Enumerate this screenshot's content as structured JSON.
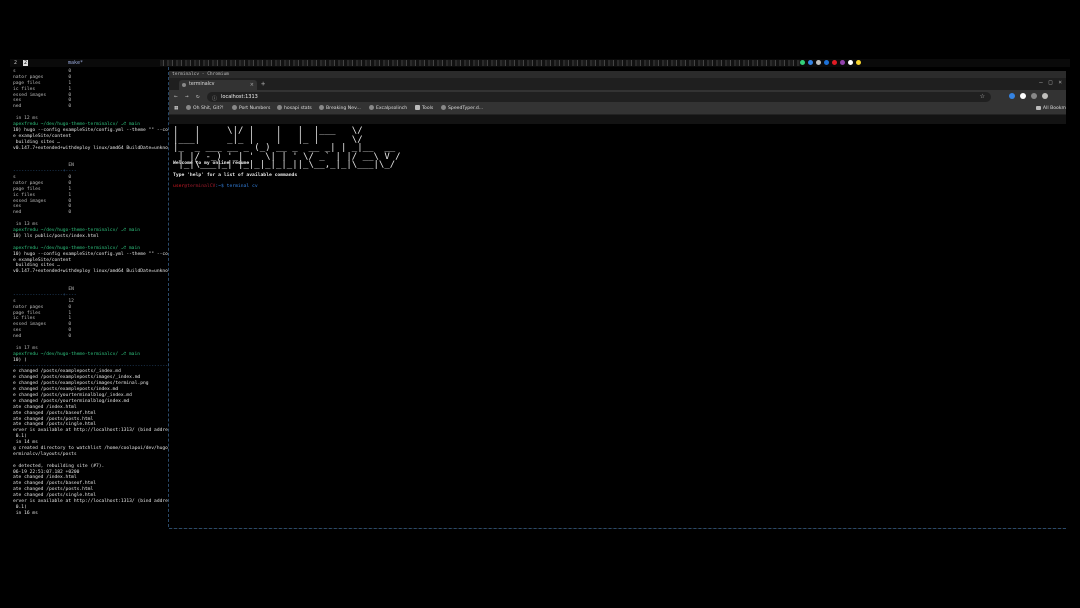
{
  "topbar": {
    "workspace_1": "2",
    "workspace_2": "2",
    "active_app": "make*",
    "tray_colors": [
      "#33d17a",
      "#3584e4",
      "#c0bfbc",
      "#1c71d8",
      "#e01b24",
      "#9141ac",
      "#ffffff",
      "#f6d32d"
    ]
  },
  "terminal": {
    "lines": [
      {
        "cls": "c-dim",
        "t": "s                   0"
      },
      {
        "cls": "c-dim",
        "t": "nator pages         0"
      },
      {
        "cls": "c-dim",
        "t": "page files          1"
      },
      {
        "cls": "c-dim",
        "t": "ic files            1"
      },
      {
        "cls": "c-dim",
        "t": "essed images        0"
      },
      {
        "cls": "c-dim",
        "t": "ses                 0"
      },
      {
        "cls": "c-dim",
        "t": "ned                 0"
      },
      {
        "cls": "c-dim",
        "t": ""
      },
      {
        "cls": "c-dim",
        "t": " in 12 ms"
      },
      {
        "cls": "c-user",
        "t": "apexfredu ~/dev/hugo-theme-terminalcv/ ⎇ main"
      },
      {
        "cls": "c-info",
        "t": "10) hugo --config exampleSite/config.yml --theme \"\" --cont"
      },
      {
        "cls": "c-info",
        "t": "e exampleSite/content"
      },
      {
        "cls": "c-info",
        "t": " building sites …"
      },
      {
        "cls": "c-info",
        "t": "v0.147.7+extended+withdeploy linux/amd64 BuildDate=unknown"
      },
      {
        "cls": "c-dim",
        "t": ""
      },
      {
        "cls": "c-dim",
        "t": ""
      },
      {
        "cls": "c-dim",
        "t": "                    EN"
      },
      {
        "cls": "c-sep",
        "t": "------------------+----"
      },
      {
        "cls": "c-dim",
        "t": "s                   0"
      },
      {
        "cls": "c-dim",
        "t": "nator pages         0"
      },
      {
        "cls": "c-dim",
        "t": "page files          1"
      },
      {
        "cls": "c-dim",
        "t": "ic files            1"
      },
      {
        "cls": "c-dim",
        "t": "essed images        0"
      },
      {
        "cls": "c-dim",
        "t": "ses                 0"
      },
      {
        "cls": "c-dim",
        "t": "ned                 0"
      },
      {
        "cls": "c-dim",
        "t": ""
      },
      {
        "cls": "c-dim",
        "t": " in 13 ms"
      },
      {
        "cls": "c-user",
        "t": "apexfredu ~/dev/hugo-theme-terminalcv/ ⎇ main"
      },
      {
        "cls": "c-info",
        "t": "10) lls public/posts/index.html"
      },
      {
        "cls": "c-dim",
        "t": ""
      },
      {
        "cls": "c-user",
        "t": "apexfredu ~/dev/hugo-theme-terminalcv/ ⎇ main"
      },
      {
        "cls": "c-info",
        "t": "10) hugo --config exampleSite/config.yml --theme \"\" --cont"
      },
      {
        "cls": "c-info",
        "t": "e exampleSite/content"
      },
      {
        "cls": "c-info",
        "t": " building sites …"
      },
      {
        "cls": "c-info",
        "t": "v0.147.7+extended+withdeploy linux/amd64 BuildDate=unknown"
      },
      {
        "cls": "c-dim",
        "t": ""
      },
      {
        "cls": "c-dim",
        "t": ""
      },
      {
        "cls": "c-dim",
        "t": "                    EN"
      },
      {
        "cls": "c-sep",
        "t": "------------------+----"
      },
      {
        "cls": "c-dim",
        "t": "s                   12"
      },
      {
        "cls": "c-dim",
        "t": "nator pages         0"
      },
      {
        "cls": "c-dim",
        "t": "page files          1"
      },
      {
        "cls": "c-dim",
        "t": "ic files            1"
      },
      {
        "cls": "c-dim",
        "t": "essed images        0"
      },
      {
        "cls": "c-dim",
        "t": "ses                 0"
      },
      {
        "cls": "c-dim",
        "t": "ned                 0"
      },
      {
        "cls": "c-dim",
        "t": ""
      },
      {
        "cls": "c-dim",
        "t": " in 17 ms"
      },
      {
        "cls": "c-user",
        "t": "apexfredu ~/dev/hugo-theme-terminalcv/ ⎇ main"
      },
      {
        "cls": "c-info",
        "t": "10) )"
      },
      {
        "cls": "c-sep",
        "t": "------------------------------------------------------------"
      },
      {
        "cls": "c-info",
        "t": "e changed /posts/exampleposts/_index.md"
      },
      {
        "cls": "c-info",
        "t": "e changed /posts/exampleposts/images/_index.md"
      },
      {
        "cls": "c-info",
        "t": "e changed /posts/exampleposts/images/terminal.png"
      },
      {
        "cls": "c-info",
        "t": "e changed /posts/exampleposts/index.md"
      },
      {
        "cls": "c-info",
        "t": "e changed /posts/yourterminalblog/_index.md"
      },
      {
        "cls": "c-info",
        "t": "e changed /posts/yourterminalblog/index.md"
      },
      {
        "cls": "c-info",
        "t": "ate changed /index.html"
      },
      {
        "cls": "c-info",
        "t": "ate changed /posts/baseof.html"
      },
      {
        "cls": "c-info",
        "t": "ate changed /posts/posts.html"
      },
      {
        "cls": "c-info",
        "t": "ate changed /posts/single.html"
      },
      {
        "cls": "c-info",
        "t": "erver is available at http://localhost:1313/ (bind address"
      },
      {
        "cls": "c-info",
        "t": " 0.1)"
      },
      {
        "cls": "c-info",
        "t": " in 14 ms"
      },
      {
        "cls": "c-info",
        "t": "g created directory to watchlist /home/coolapoi/dev/hugo-th"
      },
      {
        "cls": "c-info",
        "t": "erminalcv/layouts/posts"
      },
      {
        "cls": "c-dim",
        "t": ""
      },
      {
        "cls": "c-info",
        "t": "e detected, rebuilding site (#7)."
      },
      {
        "cls": "c-info",
        "t": "06-19 22:51:07.182 +0200"
      },
      {
        "cls": "c-info",
        "t": "ate changed /index.html"
      },
      {
        "cls": "c-info",
        "t": "ate changed /posts/baseof.html"
      },
      {
        "cls": "c-info",
        "t": "ate changed /posts/posts.html"
      },
      {
        "cls": "c-info",
        "t": "ate changed /posts/single.html"
      },
      {
        "cls": "c-info",
        "t": "erver is available at http://localhost:1313/ (bind address"
      },
      {
        "cls": "c-info",
        "t": " 0.1)"
      },
      {
        "cls": "c-info",
        "t": " in 16 ms"
      }
    ]
  },
  "browser": {
    "window_title": "terminalcv - Chromium",
    "tab_title": "terminalcv",
    "tab_close": "×",
    "new_tab": "+",
    "url": "localhost:1313",
    "bookmarks": [
      "Oh Shit, Git?!",
      "Port Numbers",
      "hosapi stats",
      "Breaking Nev...",
      "Excalpsolinch",
      "Tools",
      "SpeedTyper.d..."
    ],
    "all_bookmarks": "All Bookm",
    "ext_colors": [
      "#3584e4",
      "#ffffff",
      "#888888",
      "#c0bfbc"
    ]
  },
  "page": {
    "ascii_art": "|   |     \\|/ |    |   |  |___   \\/\n|___|     _|_ |    |   |_ |      \\/\n|_  _ ___ __ _ (_) __ _  __ _| | _|__  __\n | |/ -_) '_| '  \\| | ' \\/ _` | |/ __\\ V /\n |_|\\___|_| |_|_|_|_|_||_\\__,_|_|\\___|\\_/",
    "welcome": "Welcome to my online resume",
    "help": "Type 'help' for a list of available commands",
    "prompt_user": "user",
    "prompt_at": "@terminalCV",
    "prompt_path": ":~$",
    "prompt_cmd": " terminal cv"
  }
}
